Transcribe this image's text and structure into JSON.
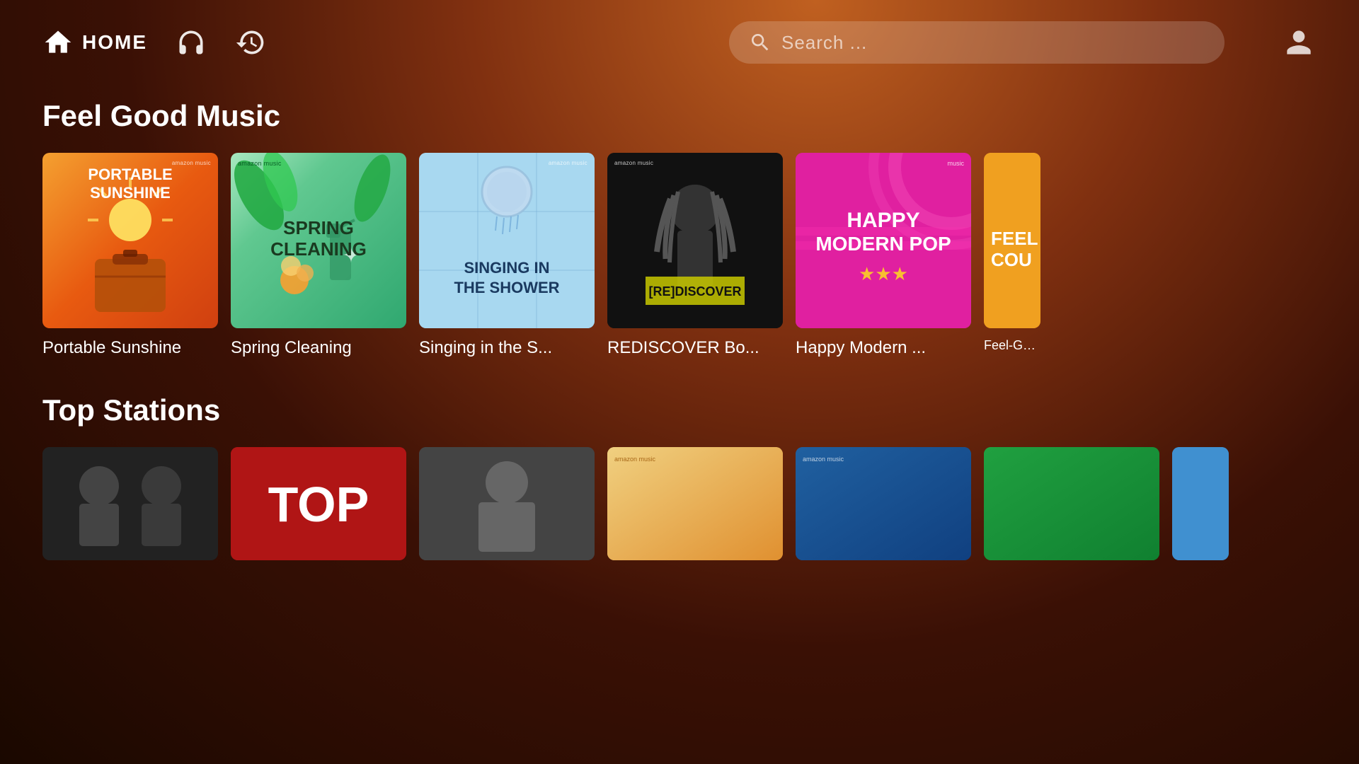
{
  "header": {
    "home_label": "HOME",
    "search_placeholder": "Search ...",
    "nav": {
      "home": "home",
      "headphones": "headphones",
      "history": "history",
      "user": "user"
    }
  },
  "sections": {
    "feel_good": {
      "title": "Feel Good Music",
      "cards": [
        {
          "id": "portable-sunshine",
          "title": "Portable Sunshine",
          "label": "Portable Sunshine",
          "badge": "amazon music"
        },
        {
          "id": "spring-cleaning",
          "title": "Spring Cleaning",
          "label": "Spring Cleaning",
          "badge": "amazon music"
        },
        {
          "id": "singing-shower",
          "title": "Singing in the S...",
          "label": "Singing in the S...",
          "badge": "amazon music"
        },
        {
          "id": "rediscover",
          "title": "REDISCOVER Bo...",
          "label": "REDISCOVER Bo...",
          "badge": "amazon music"
        },
        {
          "id": "happy-modern-pop",
          "title": "Happy Modern ...",
          "label": "Happy Modern ...",
          "badge": "music"
        },
        {
          "id": "feel-good-partial",
          "title": "Feel-Go...",
          "label": "Feel-Go...",
          "badge": ""
        }
      ]
    },
    "top_stations": {
      "title": "Top Stations",
      "cards": [
        {
          "id": "station-1",
          "label": ""
        },
        {
          "id": "station-top",
          "label": "ToP",
          "top_text": "TOP"
        },
        {
          "id": "station-3",
          "label": ""
        },
        {
          "id": "station-4",
          "label": ""
        },
        {
          "id": "station-amazon",
          "label": "",
          "badge": "amazon music"
        },
        {
          "id": "station-6",
          "label": ""
        },
        {
          "id": "station-partial",
          "label": ""
        }
      ]
    }
  }
}
